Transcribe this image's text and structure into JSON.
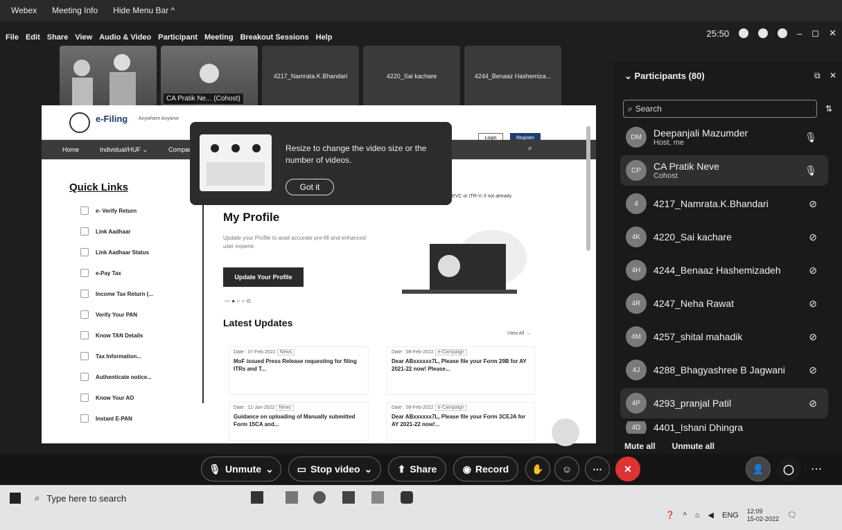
{
  "titlebar": {
    "app": "Webex",
    "meeting_info": "Meeting Info",
    "hide_menu": "Hide Menu Bar ^"
  },
  "menu": [
    "File",
    "Edit",
    "Share",
    "View",
    "Audio & Video",
    "Participant",
    "Meeting",
    "Breakout Sessions",
    "Help"
  ],
  "clock": "25:50",
  "video_tiles": [
    {
      "label": ""
    },
    {
      "label": "CA Pratik Ne... (Cohost)"
    },
    {
      "label": "4217_Namrata.K.Bhandari"
    },
    {
      "label": "4220_Sai kachare"
    },
    {
      "label": "4244_Benaaz Hashemiza..."
    }
  ],
  "efiling": {
    "logo": "e-Filing",
    "logo_tag": "Anywhere Anytime",
    "nav": [
      "Home",
      "Individual/HUF ⌄",
      "Company"
    ],
    "login": "Login",
    "register": "Register",
    "quick_links_title": "Quick Links",
    "quick_links": [
      "e- Verify Return",
      "Link Aadhaar",
      "Link Aadhaar Status",
      "e-Pay Tax",
      "Income Tax Return (...",
      "Verify Your PAN",
      "Know TAN Details",
      "Tax Information...",
      "Authenticate notice...",
      "Know Your AO",
      "Instant E-PAN"
    ],
    "banner_text": "EVC or ITR-V, if not already",
    "profile_title": "My Profile",
    "profile_desc": "Update your Profile to avail accurate pre-fill and enhanced user experie",
    "profile_btn": "Update Your Profile",
    "latest_title": "Latest Updates",
    "view_all": "View All →",
    "updates": [
      {
        "date": "Date : 07-Feb-2022",
        "tag": "News",
        "text": "MoF issued Press Release requesting for filing ITRs and T..."
      },
      {
        "date": "Date : 08-Feb-2022",
        "tag": "e-Campaign",
        "text": "Dear ABxxxxxx7L, Please file your Form 29B for AY 2021-22 now! Please..."
      },
      {
        "date": "Date : 11-Jan-2022",
        "tag": "News",
        "text": "Guidance on uploading of Manually submitted Form 15CA and..."
      },
      {
        "date": "Date : 08-Feb-2022",
        "tag": "e-Campaign",
        "text": "Dear ABxxxxxx7L, Please file your Form 3CEJA for AY 2021-22 now!..."
      }
    ]
  },
  "tooltip": {
    "text": "Resize to change the video size or the number of videos.",
    "button": "Got it"
  },
  "participants": {
    "title": "Participants (80)",
    "search_placeholder": "Search",
    "list": [
      {
        "initials": "DM",
        "name": "Deepanjali Mazumder",
        "sub": "Host, me"
      },
      {
        "initials": "CP",
        "name": "CA Pratik Neve",
        "sub": "Cohost"
      },
      {
        "initials": "4",
        "name": "4217_Namrata.K.Bhandari",
        "sub": ""
      },
      {
        "initials": "4K",
        "name": "4220_Sai kachare",
        "sub": ""
      },
      {
        "initials": "4H",
        "name": "4244_Benaaz Hashemizadeh",
        "sub": ""
      },
      {
        "initials": "4R",
        "name": "4247_Neha Rawat",
        "sub": ""
      },
      {
        "initials": "4M",
        "name": "4257_shital mahadik",
        "sub": ""
      },
      {
        "initials": "4J",
        "name": "4288_Bhagyashree B Jagwani",
        "sub": ""
      },
      {
        "initials": "4P",
        "name": "4293_pranjal Patil",
        "sub": ""
      },
      {
        "initials": "4D",
        "name": "4401_Ishani Dhingra",
        "sub": ""
      }
    ],
    "mute_all": "Mute all",
    "unmute_all": "Unmute all"
  },
  "controls": {
    "unmute": "Unmute",
    "stop_video": "Stop video",
    "share": "Share",
    "record": "Record"
  },
  "taskbar": {
    "search": "Type here to search",
    "lang": "ENG",
    "time": "12:09",
    "date": "15-02-2022"
  }
}
